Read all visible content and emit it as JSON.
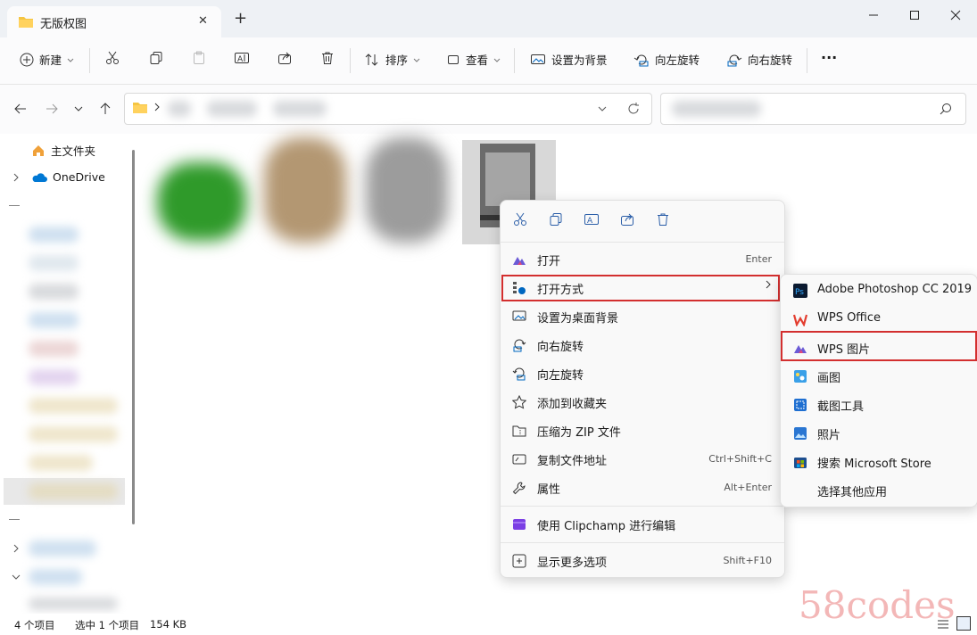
{
  "window": {
    "tab_title": "无版权图",
    "tab_close": "✕",
    "new_tab": "+"
  },
  "toolbar": {
    "new_label": "新建",
    "sort_label": "排序",
    "view_label": "查看",
    "set_bg_label": "设置为背景",
    "rotate_left_label": "向左旋转",
    "rotate_right_label": "向右旋转",
    "more_label": "···"
  },
  "sidebar": {
    "home_label": "主文件夹",
    "onedrive_label": "OneDrive"
  },
  "context_menu": {
    "items": [
      {
        "label": "打开",
        "shortcut": "Enter"
      },
      {
        "label": "打开方式",
        "shortcut": ""
      },
      {
        "label": "设置为桌面背景",
        "shortcut": ""
      },
      {
        "label": "向右旋转",
        "shortcut": ""
      },
      {
        "label": "向左旋转",
        "shortcut": ""
      },
      {
        "label": "添加到收藏夹",
        "shortcut": ""
      },
      {
        "label": "压缩为 ZIP 文件",
        "shortcut": ""
      },
      {
        "label": "复制文件地址",
        "shortcut": "Ctrl+Shift+C"
      },
      {
        "label": "属性",
        "shortcut": "Alt+Enter"
      },
      {
        "label": "使用 Clipchamp 进行编辑",
        "shortcut": ""
      },
      {
        "label": "显示更多选项",
        "shortcut": "Shift+F10"
      }
    ]
  },
  "open_with": {
    "items": [
      {
        "label": "Adobe Photoshop CC 2019"
      },
      {
        "label": "WPS Office"
      },
      {
        "label": "WPS 图片"
      },
      {
        "label": "画图"
      },
      {
        "label": "截图工具"
      },
      {
        "label": "照片"
      },
      {
        "label": "搜索 Microsoft Store"
      },
      {
        "label": "选择其他应用"
      }
    ]
  },
  "status": {
    "item_count": "4 个项目",
    "selected": "选中 1 个项目",
    "size": "154 KB"
  },
  "watermark": "58codes",
  "colors": {
    "highlight_box": "#d32f2f",
    "accent": "#0067c0"
  }
}
